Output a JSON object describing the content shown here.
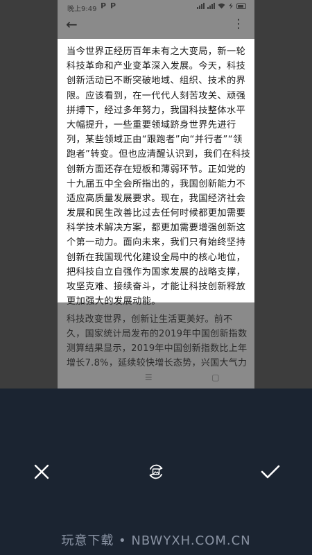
{
  "status_bar": {
    "time": "晚上9:49",
    "notif_icons": [
      "P",
      "P"
    ],
    "right_icons": [
      "signal-icon",
      "signal-icon",
      "wifi-icon",
      "charging-icon",
      "battery-icon"
    ]
  },
  "cropped_text_lines": [
    "当今世界正经历百年未有之大变局，新一轮",
    "科技革命和产业变革深入发展。今天，科技",
    "创新活动已不断突破地域、组织、技术的界",
    "限。应该看到，在一代代人刻苦攻关、顽强",
    "拼搏下，经过多年努力，我国科技整体水平",
    "大幅提升，一些重要领域跻身世界先进行",
    "列，某些领域正由“跟跑者”向“并行者”“领",
    "跑者”转变。但也应清醒认识到，我们在科技",
    "创新方面还存在短板和薄弱环节。正如党的",
    "十九届五中全会所指出的，我国创新能力不",
    "适应高质量发展要求。现在，我国经济社会",
    "发展和民生改善比过去任何时候都更加需要",
    "科学技术解决方案，都更加需要增强创新这",
    "个第一动力。面向未来，我们只有始终坚持",
    "创新在我国现代化建设全局中的核心地位，",
    "把科技自立自强作为国家发展的战略支撑，",
    "攻坚克难、接续奋斗，才能让科技创新释放",
    "更加强大的发展动能。"
  ],
  "below_text_lines": [
    "科技改变世界，创新让生活更美好。前不",
    "久，国家统计局发布的2019年中国创新指数",
    "测算结果显示，2019年中国创新指数比上年",
    "增长7.8%，延续较快增长态势，兴国大气力"
  ],
  "watermark": "玩意下载 • NBWYXH.COM.CN",
  "icons": {
    "cancel": "close-icon",
    "rotate": "rotate-image-icon",
    "confirm": "checkmark-icon"
  },
  "colors": {
    "bottom_panel": "#1b2431",
    "crop_area": "#ffffff",
    "dimmed_overlay": "#8a8a8a"
  }
}
